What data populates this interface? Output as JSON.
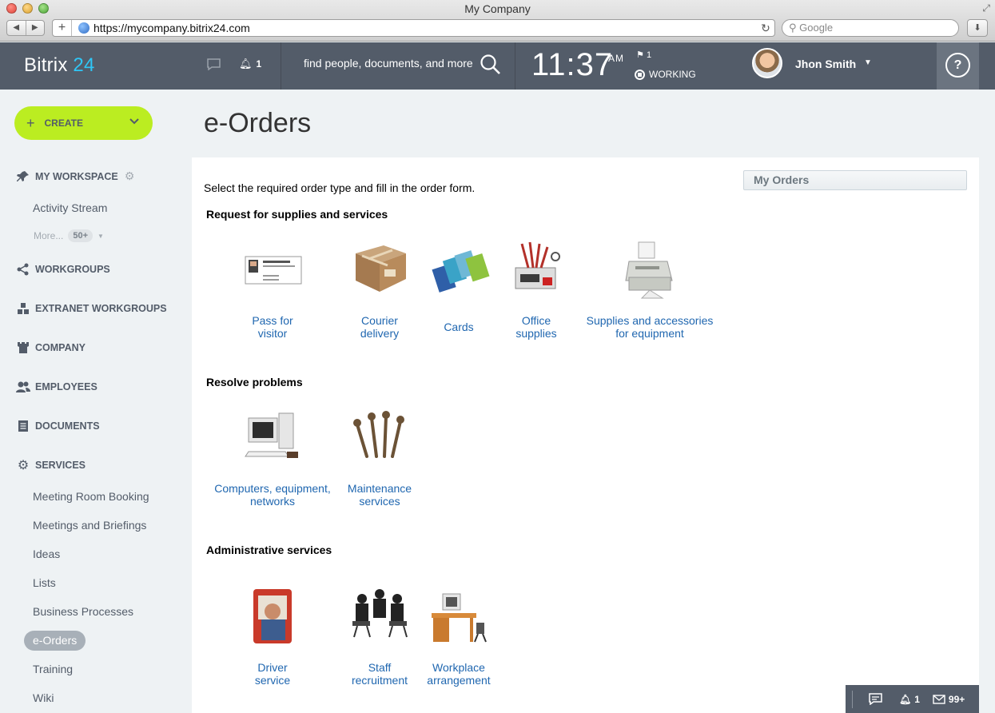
{
  "browser": {
    "window_title": "My Company",
    "url": "https://mycompany.bitrix24.com",
    "search_placeholder": "Google"
  },
  "header": {
    "logo_text": "Bitrix",
    "logo_num": "24",
    "notifications_count": "1",
    "search_placeholder": "find people, documents, and more",
    "time": "11:37",
    "ampm": "AM",
    "tasks_count": "1",
    "status": "WORKING",
    "user_name": "Jhon Smith",
    "help_label": "?"
  },
  "sidebar": {
    "create_label": "CREATE",
    "sections": {
      "workspace": "MY WORKSPACE",
      "workgroups": "WORKGROUPS",
      "extranet": "EXTRANET WORKGROUPS",
      "company": "COMPANY",
      "employees": "EMPLOYEES",
      "documents": "DOCUMENTS",
      "services": "SERVICES"
    },
    "workspace_items": [
      "Activity Stream"
    ],
    "more_label": "More...",
    "more_count": "50+",
    "services_items": [
      "Meeting Room Booking",
      "Meetings and Briefings",
      "Ideas",
      "Lists",
      "Business Processes",
      "e-Orders",
      "Training",
      "Wiki"
    ]
  },
  "main": {
    "title": "e-Orders",
    "intro": "Select the required order type and fill in the order form.",
    "my_orders": "My Orders",
    "groups": [
      {
        "title": "Request for supplies and services",
        "items": [
          {
            "l1": "Pass for",
            "l2": "visitor",
            "icon": "business-card-icon"
          },
          {
            "l1": "Courier",
            "l2": "delivery",
            "icon": "parcel-icon"
          },
          {
            "l1": "Cards",
            "l2": "",
            "icon": "cards-icon"
          },
          {
            "l1": "Office",
            "l2": "supplies",
            "icon": "office-supplies-icon"
          },
          {
            "l1": "Supplies and accessories",
            "l2": "for equipment",
            "icon": "printer-icon"
          }
        ]
      },
      {
        "title": "Resolve problems",
        "items": [
          {
            "l1": "Computers, equipment,",
            "l2": "networks",
            "icon": "computer-icon"
          },
          {
            "l1": "Maintenance",
            "l2": "services",
            "icon": "wrenches-icon"
          }
        ]
      },
      {
        "title": "Administrative services",
        "items": [
          {
            "l1": "Driver",
            "l2": "service",
            "icon": "driver-icon"
          },
          {
            "l1": "Staff",
            "l2": "recruitment",
            "icon": "meeting-people-icon"
          },
          {
            "l1": "Workplace",
            "l2": "arrangement",
            "icon": "desk-icon"
          }
        ]
      }
    ]
  },
  "bottom_bar": {
    "notifications": "1",
    "messages": "99+"
  }
}
